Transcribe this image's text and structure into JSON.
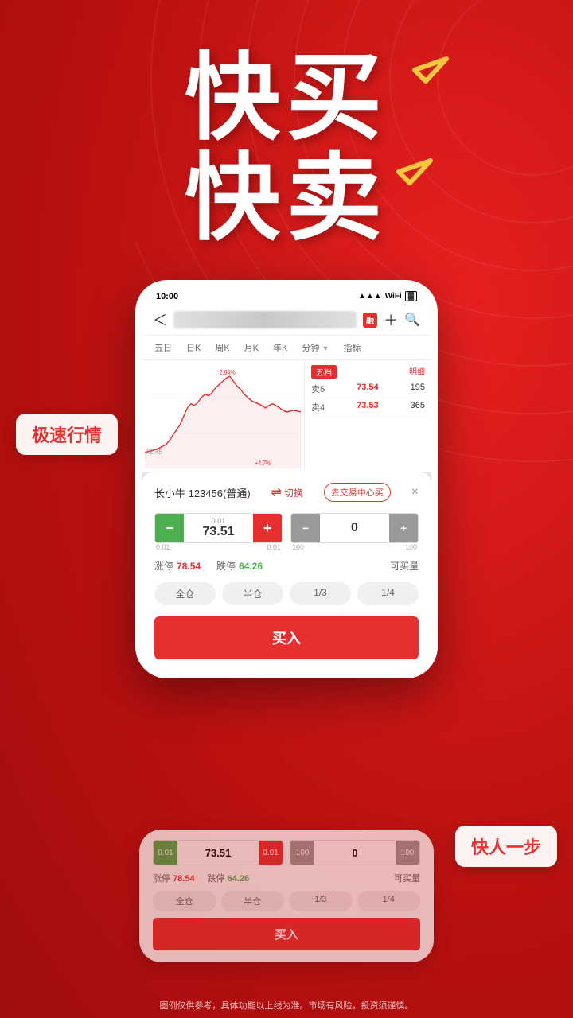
{
  "background": {
    "color": "#cc1a1a"
  },
  "hero": {
    "line1": "快买",
    "line2": "快卖"
  },
  "phone": {
    "status": {
      "time": "10:00",
      "signal": "●●●",
      "wifi": "WiFi",
      "battery": "□"
    },
    "nav": {
      "back": "＜",
      "rong_badge": "融",
      "plus": "＋",
      "search": "🔍"
    },
    "tabs": [
      {
        "label": "五日",
        "active": false
      },
      {
        "label": "日K",
        "active": false
      },
      {
        "label": "周K",
        "active": false
      },
      {
        "label": "月K",
        "active": false
      },
      {
        "label": "年K",
        "active": false
      },
      {
        "label": "分钟",
        "active": false
      },
      {
        "label": "指标",
        "active": false
      }
    ],
    "chart": {
      "y_label": "72.45",
      "pct": "+4.7%",
      "high_pct": "2.94%"
    },
    "order_book": {
      "header_left": "五档",
      "header_right": "明细",
      "rows": [
        {
          "label": "卖5",
          "price": "73.54",
          "vol": "195"
        },
        {
          "label": "卖4",
          "price": "73.53",
          "vol": "365"
        }
      ]
    }
  },
  "trade_card": {
    "stock_name": "长小牛 123456(普通)",
    "switch_label": "切换",
    "trade_center_label": "去交易中心买",
    "close_icon": "×",
    "price_input": {
      "minus_label": "−",
      "step_label": "0.01",
      "value": "73.51",
      "plus_label": "+",
      "plus_step": "0.01"
    },
    "qty_input": {
      "minus_label": "−",
      "step_label": "100",
      "value": "0",
      "plus_label": "+",
      "plus_step": "100"
    },
    "info": {
      "limit_up_label": "涨停",
      "limit_up_val": "78.54",
      "limit_down_label": "跌停",
      "limit_down_val": "64.26",
      "avail_label": "可买量"
    },
    "quick_btns": [
      "全仓",
      "半仓",
      "1/3",
      "1/4"
    ],
    "buy_label": "买入"
  },
  "labels": {
    "speed": "极速行情",
    "fast": "快人一步"
  },
  "second_card": {
    "price_input": {
      "step_minus": "0.01",
      "value": "73.51",
      "step_plus": "0.01"
    },
    "qty_input": {
      "step_minus": "100",
      "value": "0",
      "step_plus": "100"
    },
    "info": {
      "limit_up_label": "涨停",
      "limit_up_val": "78.54",
      "limit_down_label": "跌停",
      "limit_down_val": "64.26",
      "avail_label": "可买量"
    },
    "quick_btns": [
      "全仓",
      "半仓",
      "1/3",
      "1/4"
    ],
    "buy_label": "买入"
  },
  "disclaimer": "图例仅供参考，具体功能以上线为准。市场有风险，投资须谨慎。"
}
